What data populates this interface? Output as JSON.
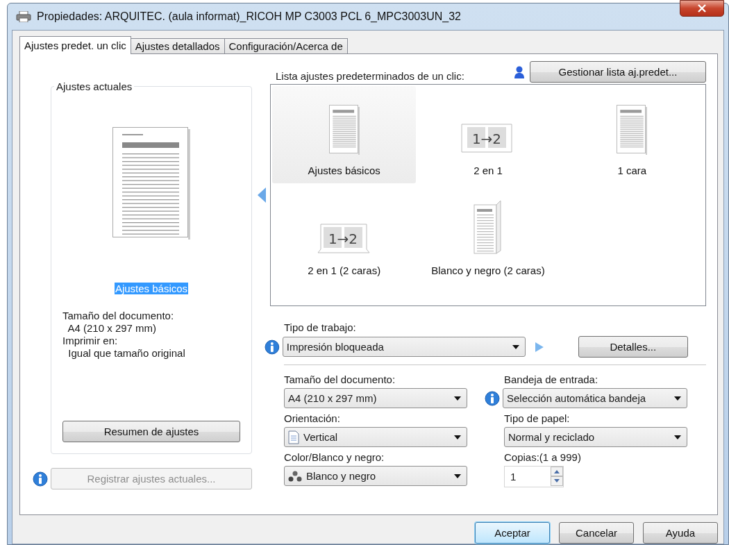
{
  "window": {
    "title": "Propiedades: ARQUITEC. (aula informat)_RICOH MP C3003 PCL 6_MPC3003UN_32"
  },
  "tabs": [
    {
      "label": "Ajustes predet. un clic",
      "selected": true
    },
    {
      "label": "Ajustes detallados",
      "selected": false
    },
    {
      "label": "Configuración/Acerca de",
      "selected": false
    }
  ],
  "current_settings": {
    "title": "Ajustes actuales",
    "name": "Ajustes básicos",
    "details": [
      "Tamaño del documento:",
      "  A4 (210 x 297 mm)",
      "Imprimir en:",
      "  Igual que tamaño original"
    ],
    "summary_button": "Resumen de ajustes",
    "register_button": {
      "label": "Registrar ajustes actuales...",
      "disabled": true
    }
  },
  "presets": {
    "title": "Lista ajustes predeterminados de un clic:",
    "manage_button": "Gestionar lista aj.predet...",
    "items": [
      {
        "label": "Ajustes básicos",
        "kind": "page",
        "selected": true
      },
      {
        "label": "2 en 1",
        "kind": "combine",
        "icon_text": "1→2",
        "selected": false
      },
      {
        "label": "1 cara",
        "kind": "page",
        "selected": false
      },
      {
        "label": "2 en 1 (2 caras)",
        "kind": "combine-duplex",
        "icon_text": "1→2",
        "selected": false
      },
      {
        "label": "Blanco y negro (2 caras)",
        "kind": "duplex",
        "selected": false
      }
    ]
  },
  "job_type": {
    "label": "Tipo de trabajo:",
    "value": "Impresión bloqueada",
    "details_button": "Detalles..."
  },
  "settings": {
    "document_size": {
      "label": "Tamaño del documento:",
      "value": "A4 (210 x 297 mm)"
    },
    "input_tray": {
      "label": "Bandeja de entrada:",
      "value": "Selección automática bandeja"
    },
    "orientation": {
      "label": "Orientación:",
      "value": "Vertical"
    },
    "paper_type": {
      "label": "Tipo de papel:",
      "value": "Normal y reciclado"
    },
    "color_mode": {
      "label": "Color/Blanco y negro:",
      "value": "Blanco y negro"
    },
    "copies": {
      "label": "Copias:(1 a 999)",
      "value": "1"
    }
  },
  "buttons": [
    {
      "label": "Aceptar",
      "selected": true
    },
    {
      "label": "Cancelar",
      "selected": false
    },
    {
      "label": "Ayuda",
      "selected": false
    }
  ]
}
